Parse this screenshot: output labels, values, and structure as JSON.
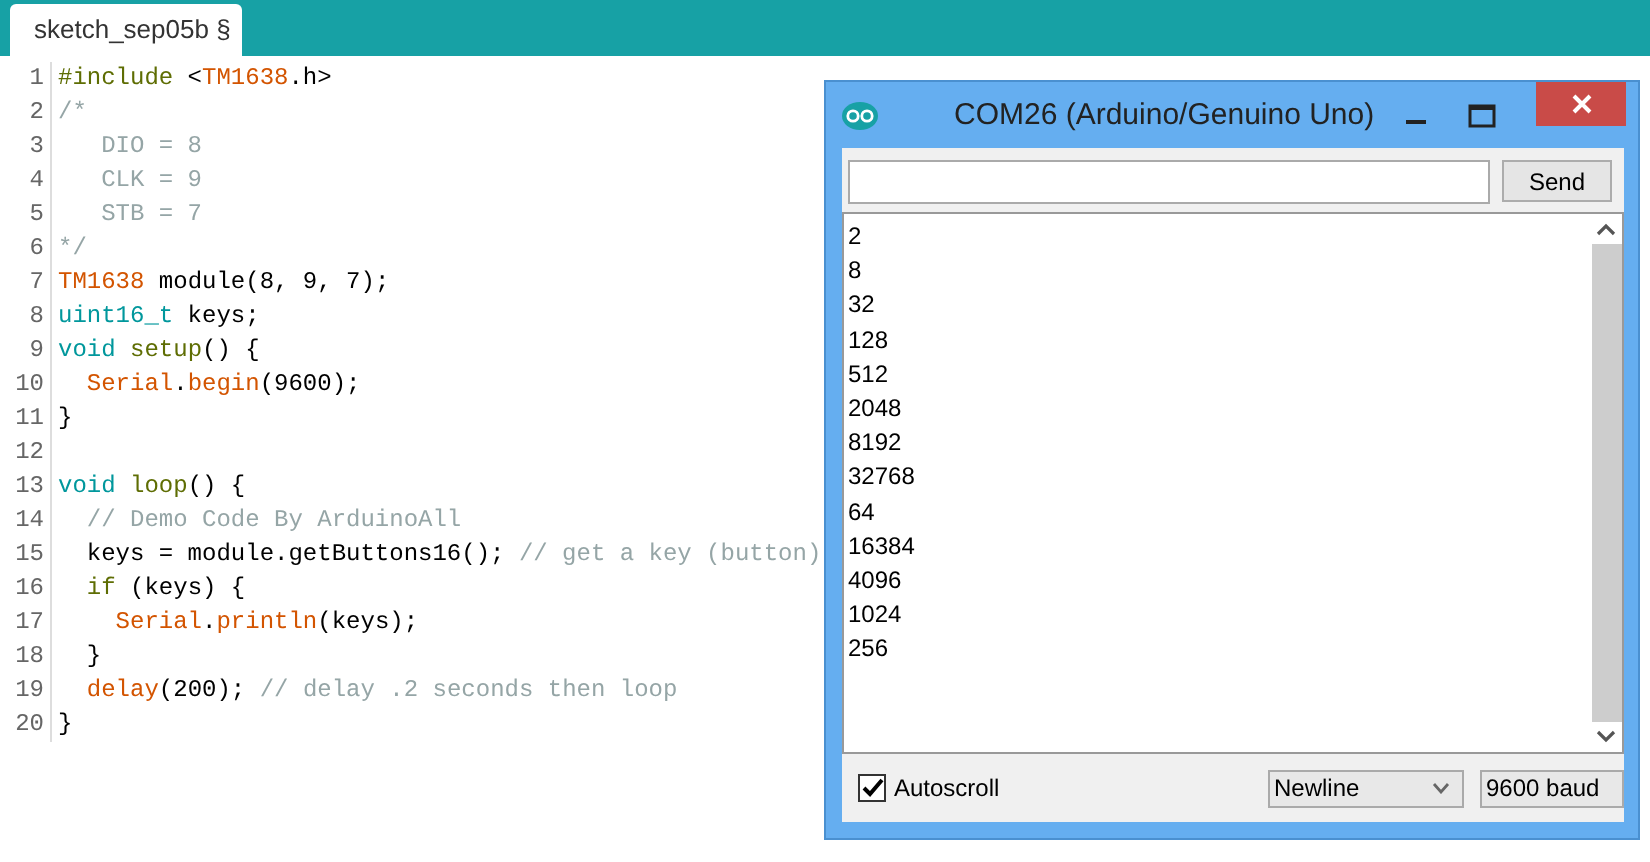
{
  "editor": {
    "tabs": [
      {
        "label": "sketch_sep05b §",
        "selected": true
      }
    ],
    "lines": [
      {
        "number": "1",
        "tokens": [
          {
            "text": "#include",
            "kind": "keyword"
          },
          {
            "text": " <",
            "kind": "plain"
          },
          {
            "text": "TM1638",
            "kind": "function"
          },
          {
            "text": ".h>",
            "kind": "plain"
          }
        ]
      },
      {
        "number": "2",
        "tokens": [
          {
            "text": "/*",
            "kind": "comment"
          }
        ]
      },
      {
        "number": "3",
        "tokens": [
          {
            "text": "   DIO = 8",
            "kind": "comment"
          }
        ]
      },
      {
        "number": "4",
        "tokens": [
          {
            "text": "   CLK = 9",
            "kind": "comment"
          }
        ]
      },
      {
        "number": "5",
        "tokens": [
          {
            "text": "   STB = 7",
            "kind": "comment"
          }
        ]
      },
      {
        "number": "6",
        "tokens": [
          {
            "text": "*/",
            "kind": "comment"
          }
        ]
      },
      {
        "number": "7",
        "tokens": [
          {
            "text": "TM1638",
            "kind": "function"
          },
          {
            "text": " module(8, 9, 7);",
            "kind": "plain"
          }
        ]
      },
      {
        "number": "8",
        "tokens": [
          {
            "text": "uint16_t",
            "kind": "type"
          },
          {
            "text": " keys;",
            "kind": "plain"
          }
        ]
      },
      {
        "number": "9",
        "tokens": [
          {
            "text": "void",
            "kind": "type"
          },
          {
            "text": " setup",
            "kind": "keyword"
          },
          {
            "text": "() {",
            "kind": "plain"
          }
        ]
      },
      {
        "number": "10",
        "tokens": [
          {
            "text": "  Serial",
            "kind": "function"
          },
          {
            "text": ".",
            "kind": "plain"
          },
          {
            "text": "begin",
            "kind": "function"
          },
          {
            "text": "(9600);",
            "kind": "plain"
          }
        ]
      },
      {
        "number": "11",
        "tokens": [
          {
            "text": "}",
            "kind": "plain"
          }
        ]
      },
      {
        "number": "12"
      },
      {
        "number": "13",
        "tokens": [
          {
            "text": "void",
            "kind": "type"
          },
          {
            "text": " loop",
            "kind": "keyword"
          },
          {
            "text": "() {",
            "kind": "plain"
          }
        ]
      },
      {
        "number": "14",
        "tokens": [
          {
            "text": "  // Demo Code By ArduinoAll",
            "kind": "comment"
          }
        ]
      },
      {
        "number": "15",
        "tokens": [
          {
            "text": "  keys = module.getButtons16(); ",
            "kind": "plain"
          },
          {
            "text": "// get a key (button)",
            "kind": "comment"
          }
        ]
      },
      {
        "number": "16",
        "tokens": [
          {
            "text": "  if",
            "kind": "keyword"
          },
          {
            "text": " (keys) {",
            "kind": "plain"
          }
        ]
      },
      {
        "number": "17",
        "tokens": [
          {
            "text": "    Serial",
            "kind": "function"
          },
          {
            "text": ".",
            "kind": "plain"
          },
          {
            "text": "println",
            "kind": "function"
          },
          {
            "text": "(keys);",
            "kind": "plain"
          }
        ]
      },
      {
        "number": "18",
        "tokens": [
          {
            "text": "  }",
            "kind": "plain"
          }
        ]
      },
      {
        "number": "19",
        "tokens": [
          {
            "text": "  delay",
            "kind": "function"
          },
          {
            "text": "(200); ",
            "kind": "plain"
          },
          {
            "text": "// delay .2 seconds then loop",
            "kind": "comment"
          }
        ]
      },
      {
        "number": "20",
        "tokens": [
          {
            "text": "}",
            "kind": "plain"
          }
        ]
      }
    ]
  },
  "serial_monitor": {
    "window": {
      "title": "COM26 (Arduino/Genuino Uno)"
    },
    "send_button": "Send",
    "output": [
      "2",
      "8",
      "32",
      "128",
      "512",
      "2048",
      "8192",
      "32768",
      "64",
      "16384",
      "4096",
      "1024",
      "256"
    ],
    "autoscroll": {
      "label": "Autoscroll",
      "checked": true
    },
    "line_ending": "Newline",
    "baud_rate": "9600 baud"
  }
}
